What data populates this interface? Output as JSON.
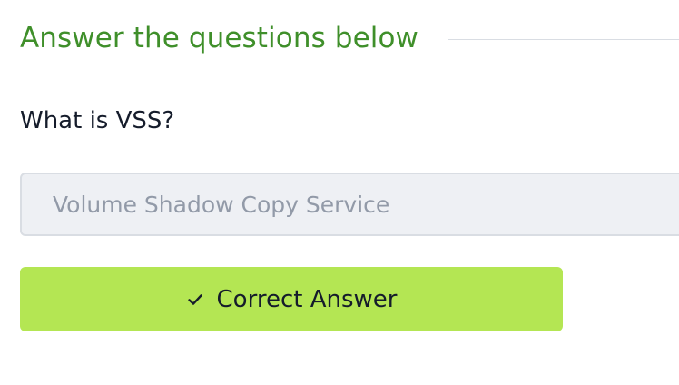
{
  "section": {
    "title": "Answer the questions below"
  },
  "question": {
    "text": "What is VSS?"
  },
  "answer": {
    "value": "Volume Shadow Copy Service"
  },
  "feedback": {
    "button_label": "Correct Answer",
    "icon": "check-icon"
  },
  "colors": {
    "title": "#3f8f2a",
    "question_text": "#151c2b",
    "input_background": "#eef0f4",
    "input_border": "#d9dde3",
    "input_text": "#929aa8",
    "button_background": "#b4e653",
    "button_text": "#151c2b"
  }
}
